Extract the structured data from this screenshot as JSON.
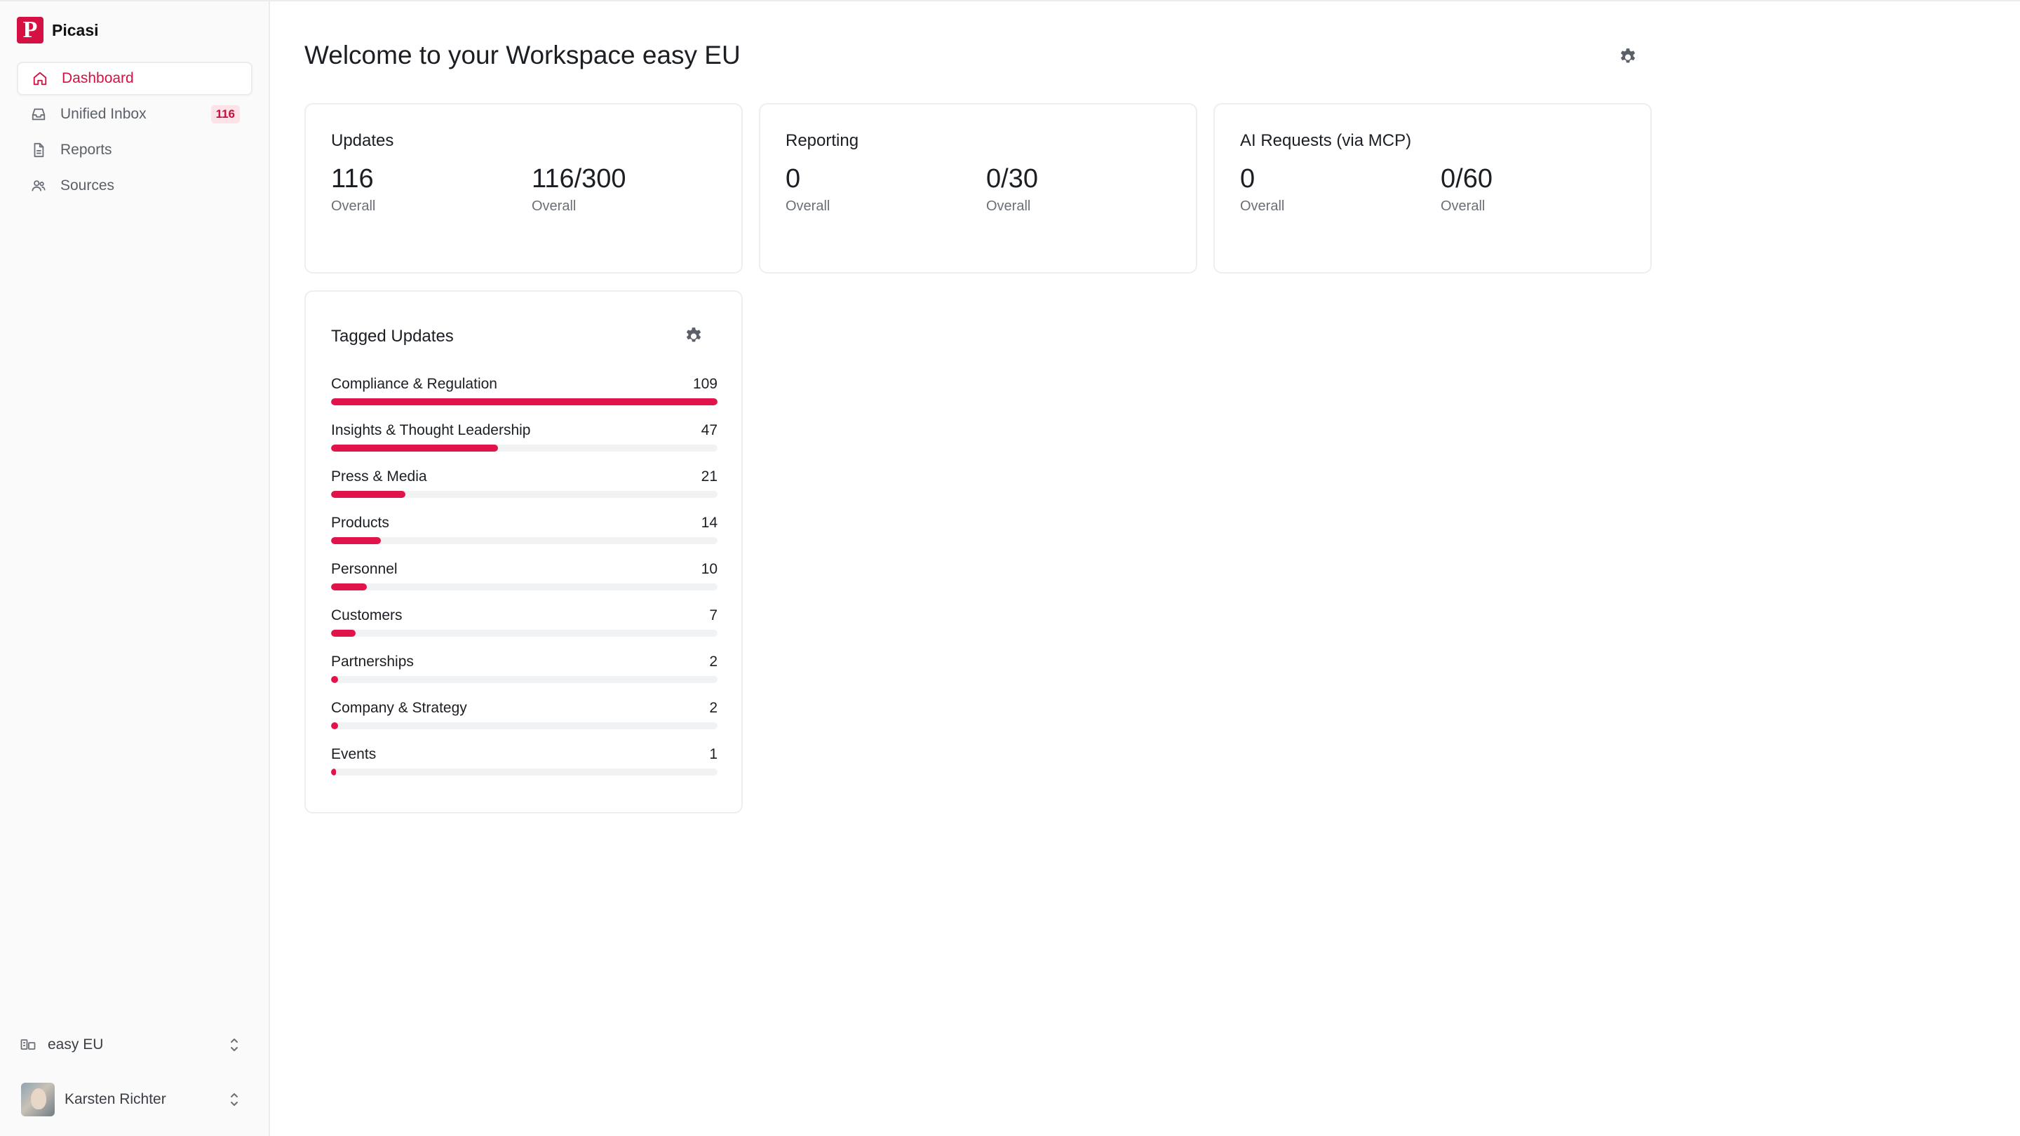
{
  "app": {
    "name": "Picasi",
    "logo_letter": "P",
    "accent": "#e0134a"
  },
  "sidebar": {
    "items": [
      {
        "label": "Dashboard",
        "icon": "home-icon",
        "active": true
      },
      {
        "label": "Unified Inbox",
        "icon": "inbox-icon",
        "badge": "116"
      },
      {
        "label": "Reports",
        "icon": "file-icon"
      },
      {
        "label": "Sources",
        "icon": "sources-icon"
      }
    ],
    "workspace": {
      "label": "easy EU",
      "icon": "workspace-icon"
    },
    "user": {
      "name": "Karsten Richter"
    }
  },
  "header": {
    "title": "Welcome to your Workspace easy EU"
  },
  "cards": [
    {
      "title": "Updates",
      "stats": [
        {
          "value": "116",
          "label": "Overall"
        },
        {
          "value": "116/300",
          "label": "Overall"
        }
      ]
    },
    {
      "title": "Reporting",
      "stats": [
        {
          "value": "0",
          "label": "Overall"
        },
        {
          "value": "0/30",
          "label": "Overall"
        }
      ]
    },
    {
      "title": "AI Requests (via MCP)",
      "stats": [
        {
          "value": "0",
          "label": "Overall"
        },
        {
          "value": "0/60",
          "label": "Overall"
        }
      ]
    }
  ],
  "tagged": {
    "title": "Tagged Updates",
    "max": 109,
    "items": [
      {
        "label": "Compliance & Regulation",
        "count": "109",
        "value": 109
      },
      {
        "label": "Insights & Thought Leadership",
        "count": "47",
        "value": 47
      },
      {
        "label": "Press & Media",
        "count": "21",
        "value": 21
      },
      {
        "label": "Products",
        "count": "14",
        "value": 14
      },
      {
        "label": "Personnel",
        "count": "10",
        "value": 10
      },
      {
        "label": "Customers",
        "count": "7",
        "value": 7
      },
      {
        "label": "Partnerships",
        "count": "2",
        "value": 2
      },
      {
        "label": "Company & Strategy",
        "count": "2",
        "value": 2
      },
      {
        "label": "Events",
        "count": "1",
        "value": 1
      }
    ]
  }
}
